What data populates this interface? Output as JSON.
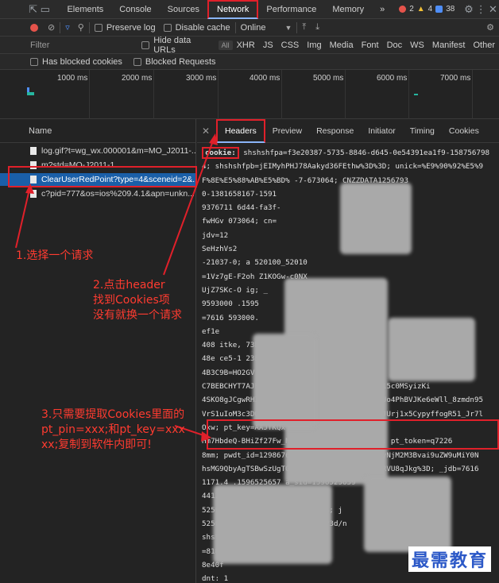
{
  "tabbar": {
    "tabs": [
      "Elements",
      "Console",
      "Sources",
      "Network",
      "Performance",
      "Memory"
    ],
    "more": "»",
    "errors": "2",
    "warnings": "4",
    "messages": "38",
    "icons": [
      "inspect-icon",
      "device-icon",
      "gear-icon",
      "more-vertical-icon",
      "close-icon"
    ]
  },
  "toolbar": {
    "preserve_log": "Preserve log",
    "disable_cache": "Disable cache",
    "throttle": "Online"
  },
  "filterbar": {
    "placeholder": "Filter",
    "hide_data_urls": "Hide data URLs",
    "types": [
      "All",
      "XHR",
      "JS",
      "CSS",
      "Img",
      "Media",
      "Font",
      "Doc",
      "WS",
      "Manifest",
      "Other"
    ],
    "blocked_cookies": "Has blocked cookies",
    "blocked_requests": "Blocked Requests"
  },
  "timeline": {
    "ticks": [
      "1000 ms",
      "2000 ms",
      "3000 ms",
      "4000 ms",
      "5000 ms",
      "6000 ms",
      "7000 ms"
    ]
  },
  "requests": {
    "header": "Name",
    "items": [
      "log.gif?t=wg_wx.000001&m=MO_J2011-...",
      "m?std=MO-J2011-1",
      "ClearUserRedPoint?type=4&sceneid=2&...",
      "c?pid=777&os=ios%209.4.1&apn=unkn..."
    ]
  },
  "details": {
    "tabs": [
      "Headers",
      "Preview",
      "Response",
      "Initiator",
      "Timing",
      "Cookies"
    ],
    "cookie_label": "cookie:",
    "lines": [
      " shshshfpa=f3e20387-5735-8846-d645-0e54391ea1f9-158756798",
      "4; shshshfpb=jEIMyhPHJ78Aakyd36FEthw%3D%3D; unick=%E9%90%92%E5%9",
      "F%8E%E5%88%AB%E5%BD%              -7-673064; CNZZDATA1256793",
      "0-1381658167-1591",
      "9376711              6d44-fa3f-",
      "fwHGv                                      073064; cn=",
      "jdv=12",
      "SeHzhVs2",
      "-21037-0; a                           520100_52010",
      "=1Vz7gE-F2oh                          Z1KOGw-c0NX",
      "UjZ7SKc-O                        ig; _",
      "9593000                 .1595",
      "=7616              593000.",
      "ef1e            ",
      "408            itke,                              73b858",
      "48e            ce5-1                              23F7A",
      "4B3C9B=HO2GV                 LWRPEJHLMTDC74LNPRN5C       RH6RC",
      "C7BEBCHYT7AJFK              LO6AK4; TrackerID=606FyXo115c0MSyizKi",
      "4SKO8gJCgwRHI63bmOqumv15J33Wx49UKnpaOuljFUo4PhBVJKe6eWll_8zmdn95",
      "VrS1uIoM3c3DQw14Zv9Ws6XC-8-9Kod50lKnWSBGQJUrj1x5CypyffogR51_Jr7l",
      "Oxw; pt_key=AAJfKQx               QbIfOaFwVfh0jyanJHp",
      "Hm7HbdeQ-BHiZf27Fw_NEoQ; pt_pin=12986            064; pt_token=q7226",
      "8mm; pwdt_id=129867657-673064; wqmnx1=MDEyNjM2M3Bvai9uZW9uMiY0N",
      "hsMG9QbyAgTSBwSzUgTGVvczBiNVMvIGFzRjJuLTNRVU8qJkg%3D;   _jdb=7616",
      "1171.4                      .1596525657       a_sid=1596525659",
      "                                  4412          25674412.1595525",
      "       525674412.1.1; PPRD_                      ;4183384; j",
      "       525674463; jxsid_s_u=ht                  om/my3d/n",
      "                                                    shshshfp",
      "=818f8",
      "8e40f",
      "dnt: 1"
    ]
  },
  "annotations": {
    "a1": "1.选择一个请求",
    "a2": [
      "2.点击header",
      "找到Cookies项",
      "没有就换一个请求"
    ],
    "a3": [
      "3.只需要提取Cookies里面的",
      "pt_pin=xxx;和pt_key=xxx",
      "xx;复制到软件内即可!"
    ]
  },
  "watermark": "最需教育",
  "colors": {
    "annotation": "#ff3b30",
    "highlight_box": "#e0202a",
    "selected_row": "#1a5fa8",
    "watermark": "#2b58c7"
  }
}
